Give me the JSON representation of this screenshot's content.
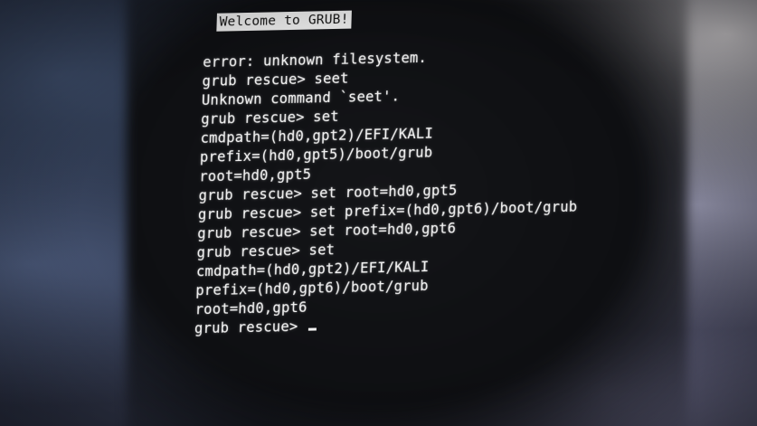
{
  "banner": "Welcome to GRUB!",
  "lines": [
    "error: unknown filesystem.",
    "grub rescue> seet",
    "Unknown command `seet'.",
    "grub rescue> set",
    "cmdpath=(hd0,gpt2)/EFI/KALI",
    "prefix=(hd0,gpt5)/boot/grub",
    "root=hd0,gpt5",
    "grub rescue> set root=hd0,gpt5",
    "grub rescue> set prefix=(hd0,gpt6)/boot/grub",
    "grub rescue> set root=hd0,gpt6",
    "grub rescue> set",
    "cmdpath=(hd0,gpt2)/EFI/KALI",
    "prefix=(hd0,gpt6)/boot/grub",
    "root=hd0,gpt6"
  ],
  "prompt": "grub rescue> ",
  "colors": {
    "text": "#f2f2f2",
    "banner_bg": "#e9e9e9",
    "screen_bg": "#0e0f12"
  }
}
